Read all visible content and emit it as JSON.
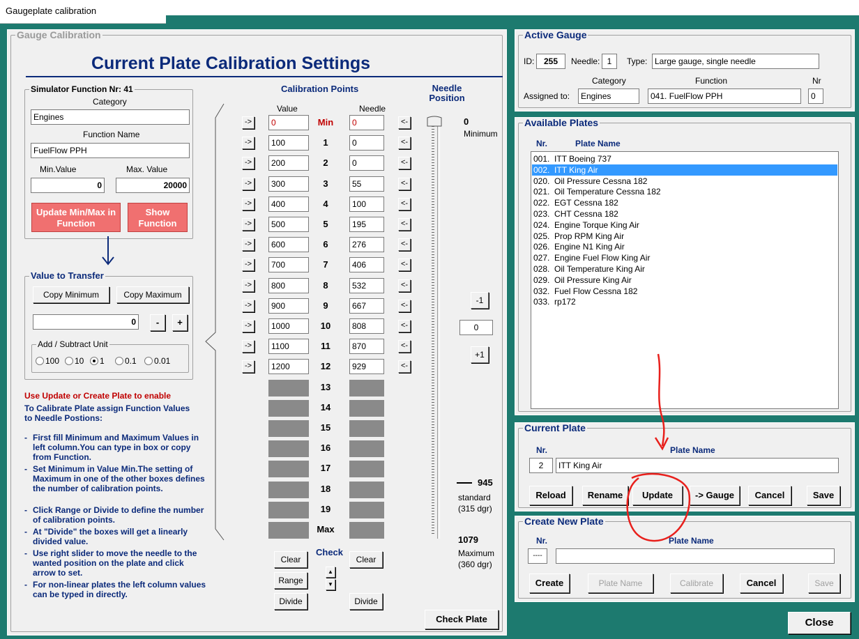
{
  "window": {
    "title": "Gaugeplate calibration"
  },
  "left": {
    "group_title": "Gauge Calibration",
    "heading": "Current Plate Calibration Settings",
    "sim": {
      "title": "Simulator Function Nr: 41",
      "category_label": "Category",
      "category": "Engines",
      "fname_label": "Function Name",
      "fname": "FuelFlow PPH",
      "min_label": "Min.Value",
      "max_label": "Max. Value",
      "min": "0",
      "max": "20000",
      "update_btn": "Update Min/Max in Function",
      "show_btn": "Show Function"
    },
    "transfer": {
      "title": "Value to Transfer",
      "copy_min": "Copy Minimum",
      "copy_max": "Copy Maximum",
      "value": "0",
      "minus": "-",
      "plus": "+",
      "unit_title": "Add / Subtract Unit",
      "units": [
        "100",
        "10",
        "1",
        "0.1",
        "0.01"
      ],
      "selected_unit": "1"
    },
    "instructions": {
      "red": "Use Update or Create Plate to enable",
      "intro": "To Calibrate Plate assign Function Values to Needle Postions:",
      "items": [
        {
          "b": "-",
          "t": "First fill Minimum and Maximum Values in left column.You can type in box or copy from Function."
        },
        {
          "b": "-",
          "t": "Set Minimum in Value Min.The setting of Maximum in one of the other  boxes defines the number of calibration points."
        },
        {
          "b": "-",
          "t": "Click Range or Divide to define the number  of calibration points."
        },
        {
          "b": "-",
          "t": "At \"Divide\" the boxes will get a linearly divided value."
        },
        {
          "b": "-",
          "t": "Use right slider to move the needle to the wanted position on the  plate and click arrow to set."
        },
        {
          "b": "-",
          "t": "For non-linear plates the left column values can be typed in directly."
        }
      ]
    },
    "cal": {
      "title": "Calibration  Points",
      "value_hdr": "Value",
      "needle_hdr": "Needle",
      "set_arrow": "->",
      "get_arrow": "<-",
      "rows": [
        {
          "label": "Min",
          "value": "0",
          "needle": "0"
        },
        {
          "label": "1",
          "value": "100",
          "needle": "0"
        },
        {
          "label": "2",
          "value": "200",
          "needle": "0"
        },
        {
          "label": "3",
          "value": "300",
          "needle": "55"
        },
        {
          "label": "4",
          "value": "400",
          "needle": "100"
        },
        {
          "label": "5",
          "value": "500",
          "needle": "195"
        },
        {
          "label": "6",
          "value": "600",
          "needle": "276"
        },
        {
          "label": "7",
          "value": "700",
          "needle": "406"
        },
        {
          "label": "8",
          "value": "800",
          "needle": "532"
        },
        {
          "label": "9",
          "value": "900",
          "needle": "667"
        },
        {
          "label": "10",
          "value": "1000",
          "needle": "808"
        },
        {
          "label": "11",
          "value": "1100",
          "needle": "870"
        },
        {
          "label": "12",
          "value": "1200",
          "needle": "929"
        }
      ],
      "disabled_rows": [
        "13",
        "14",
        "15",
        "16",
        "17",
        "18",
        "19",
        "Max"
      ],
      "clear1": "Clear",
      "clear2": "Clear",
      "check": "Check",
      "range": "Range",
      "divide1": "Divide",
      "divide2": "Divide",
      "up": "▲",
      "down": "▼"
    },
    "needle": {
      "title": "Needle Position",
      "min_val": "0",
      "min_lbl": "Minimum",
      "minus1": "-1",
      "center": "0",
      "plus1": "+1",
      "std_val": "945",
      "std_lbl": "standard",
      "std_sub": "(315 dgr)",
      "max_val": "1079",
      "max_lbl": "Maximum",
      "max_sub": "(360 dgr)",
      "check_plate": "Check Plate"
    }
  },
  "active": {
    "title": "Active Gauge",
    "id_label": "ID:",
    "id": "255",
    "needle_label": "Needle:",
    "needle": "1",
    "type_label": "Type:",
    "type": "Large gauge, single needle",
    "cat_hdr": "Category",
    "fn_hdr": "Function",
    "nr_hdr": "Nr",
    "assigned_label": "Assigned to:",
    "category": "Engines",
    "function": "041.  FuelFlow PPH",
    "nr": "0"
  },
  "plates": {
    "title": "Available Plates",
    "nr_hdr": "Nr.",
    "name_hdr": "Plate Name",
    "items": [
      {
        "nr": "001.",
        "name": "ITT Boeing 737"
      },
      {
        "nr": "002.",
        "name": "ITT King Air"
      },
      {
        "nr": "020.",
        "name": "Oil Pressure Cessna 182"
      },
      {
        "nr": "021.",
        "name": "Oil Temperature Cessna 182"
      },
      {
        "nr": "022.",
        "name": "EGT Cessna 182"
      },
      {
        "nr": "023.",
        "name": "CHT Cessna 182"
      },
      {
        "nr": "024.",
        "name": "Engine Torque King Air"
      },
      {
        "nr": "025.",
        "name": "Prop RPM King Air"
      },
      {
        "nr": "026.",
        "name": "Engine N1 King Air"
      },
      {
        "nr": "027.",
        "name": "Engine Fuel Flow King Air"
      },
      {
        "nr": "028.",
        "name": "Oil Temperature King Air"
      },
      {
        "nr": "029.",
        "name": "Oil Pressure King Air"
      },
      {
        "nr": "032.",
        "name": "Fuel Flow Cessna 182"
      },
      {
        "nr": "033.",
        "name": "rp172"
      }
    ],
    "selected": "002."
  },
  "current": {
    "title": "Current Plate",
    "nr_hdr": "Nr.",
    "name_hdr": "Plate Name",
    "nr": "2",
    "name": "ITT King Air",
    "reload": "Reload",
    "rename": "Rename",
    "update": "Update",
    "to_gauge": "-> Gauge",
    "cancel": "Cancel",
    "save": "Save"
  },
  "create": {
    "title": "Create New Plate",
    "nr_hdr": "Nr.",
    "name_hdr": "Plate Name",
    "nr": "----",
    "name": "",
    "create": "Create",
    "plate_name": "Plate Name",
    "calibrate": "Calibrate",
    "cancel": "Cancel",
    "save": "Save"
  },
  "close": "Close",
  "colors": {
    "teal": "#1d7a6f",
    "blue": "#0b2a7a",
    "red_btn": "#f07070",
    "annotation": "#e8201c",
    "selection": "#3399ff"
  }
}
